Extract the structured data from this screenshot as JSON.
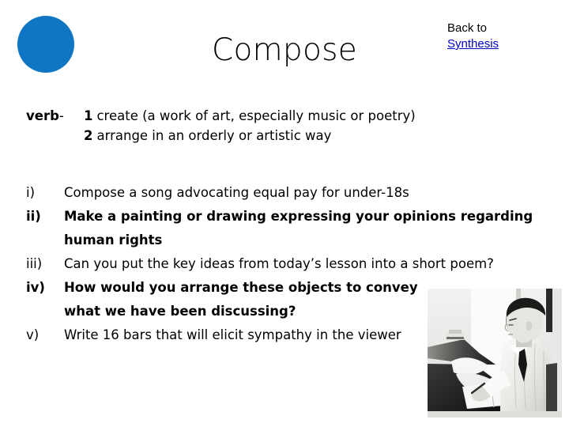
{
  "header": {
    "title": "Compose",
    "logo_color": "#0f76c3",
    "back_label": "Back to",
    "back_target": "Synthesis",
    "link_color": "#0000c8"
  },
  "definition": {
    "part_of_speech": "verb",
    "dash": "-",
    "senses": [
      {
        "number": "1",
        "text": "create (a work of art, especially music or poetry)"
      },
      {
        "number": "2",
        "text": "arrange in an orderly or artistic way"
      }
    ]
  },
  "tasks": [
    {
      "marker": "i)",
      "bold": false,
      "lines": [
        "Compose a song advocating equal pay for under-18s"
      ]
    },
    {
      "marker": "ii)",
      "bold": true,
      "lines": [
        "Make a painting or drawing expressing your opinions regarding",
        "human rights"
      ]
    },
    {
      "marker": "iii)",
      "bold": false,
      "lines": [
        "Can you put the key ideas from today’s lesson into a short poem?"
      ]
    },
    {
      "marker": "iv)",
      "bold": true,
      "lines": [
        "How would you arrange these objects to convey",
        "what we have been discussing?"
      ]
    },
    {
      "marker": "v)",
      "bold": false,
      "lines": [
        "Write 16 bars that will elicit sympathy in the viewer"
      ]
    }
  ],
  "photo": {
    "alt": "black and white photograph of a man seated at a piano writing music"
  }
}
